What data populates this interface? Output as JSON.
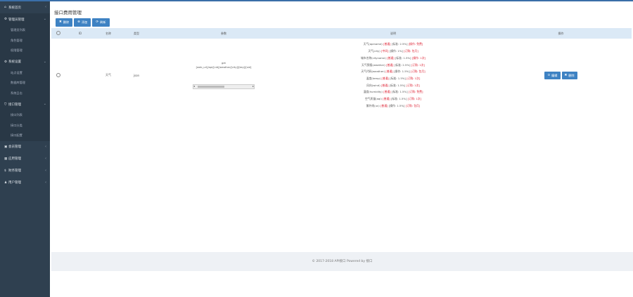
{
  "sidebar": {
    "groups": [
      {
        "icon": "home-icon",
        "label": "系统首页",
        "expanded": false
      },
      {
        "icon": "gear-icon",
        "label": "管理员管理",
        "expanded": true,
        "items": [
          "管理员列表",
          "角色管理",
          "权限管理"
        ]
      },
      {
        "icon": "gear-icon",
        "label": "系统设置",
        "expanded": true,
        "items": [
          "站点设置",
          "数据库管理",
          "系统日志"
        ]
      },
      {
        "icon": "tag-icon",
        "label": "接口管理",
        "expanded": true,
        "items": [
          "接口列表",
          "接口分类",
          "接口配置"
        ]
      },
      {
        "icon": "square-icon",
        "label": "会员管理",
        "expanded": false
      },
      {
        "icon": "grid-icon",
        "label": "应用管理",
        "expanded": false
      },
      {
        "icon": "dollar-icon",
        "label": "财务管理",
        "expanded": false
      },
      {
        "icon": "user-icon",
        "label": "用户管理",
        "expanded": false
      }
    ]
  },
  "main": {
    "title": "接口费用管理",
    "toolbar": [
      {
        "icon": "close-icon",
        "label": "删除"
      },
      {
        "icon": "plus-icon",
        "label": "添加"
      },
      {
        "icon": "refresh-icon",
        "label": "刷新"
      }
    ],
    "table": {
      "headers": [
        "",
        "ID",
        "名称",
        "类型",
        "参数",
        "说明",
        "操作"
      ],
      "row": {
        "id": "",
        "name": "天气",
        "type": "json",
        "param_top": "get",
        "param_main": "[web_url]/api/[cid]/weather/[city]/[key]/[sid]",
        "desc_lines": [
          "天气(apiname) [普通] [标准: 2.5%] [操作: 免费]",
          "天气(city) [中间] [操作: 1%] [订购: 包月]",
          "城市名称(cityname) [普通] [标准: 1.5%] [操作: 1次]",
          "天气预报(weather) [普通] [标准: 2.5%] [订购: 1次]",
          "天气代码(weather) [普通] [操作: 1.5%] [订购: 包月]",
          "温度(temp) [普通] [标准: 1.5%] [订购: 1次]",
          "风向(wind) [普通] [标准: 1.5%] [订购: 1次]",
          "湿度(humidity) [普通] [标准: 1.5%] [订购: 免费]",
          "空气质量(aqi) [普通] [标准: 1.5%] [订购: 1次]",
          "紫外线(uv) [普通] [操作: 1.5%] [订购: 包月]"
        ],
        "actions": [
          {
            "icon": "edit-icon",
            "label": "编辑"
          },
          {
            "icon": "close-icon",
            "label": "删除"
          }
        ]
      }
    }
  },
  "footer": {
    "text": "© 2017-2018 API接口 Powered by 接口"
  },
  "colors": {
    "sidebar": "#2f4050",
    "primary": "#3e82c3",
    "header_row": "#dbe9f6",
    "warn": "#dd2233"
  }
}
